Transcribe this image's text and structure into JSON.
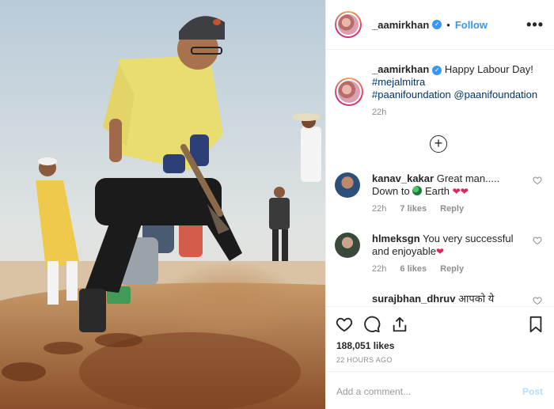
{
  "post": {
    "author": "_aamirkhan",
    "follow_label": "Follow",
    "separator": "•",
    "more_label": "•••"
  },
  "caption": {
    "username": "_aamirkhan",
    "text": "Happy Labour Day!",
    "tag1": "#mejalmitra",
    "tag2": "#paanifoundation",
    "mention": "@paanifoundation",
    "time": "22h"
  },
  "load_more_symbol": "+",
  "comments": [
    {
      "username": "kanav_kakar",
      "text_before": "Great man..... Down to",
      "earth_word": "Earth",
      "hearts": "❤❤",
      "time": "22h",
      "likes": "7 likes",
      "reply": "Reply"
    },
    {
      "username": "hlmeksgn",
      "text": "You very successful and enjoyable",
      "heart": "❤",
      "time": "22h",
      "likes": "6 likes",
      "reply": "Reply"
    },
    {
      "username": "surajbhan_dhruv",
      "text": "आपको ये"
    }
  ],
  "stats": {
    "likes": "188,051 likes",
    "ago": "22 HOURS AGO"
  },
  "comment_box": {
    "placeholder": "Add a comment...",
    "post_label": "Post"
  },
  "colors": {
    "accent": "#3897f0",
    "tag": "#003569",
    "muted": "#8e8e8e",
    "post_disabled": "#b2dffc"
  }
}
